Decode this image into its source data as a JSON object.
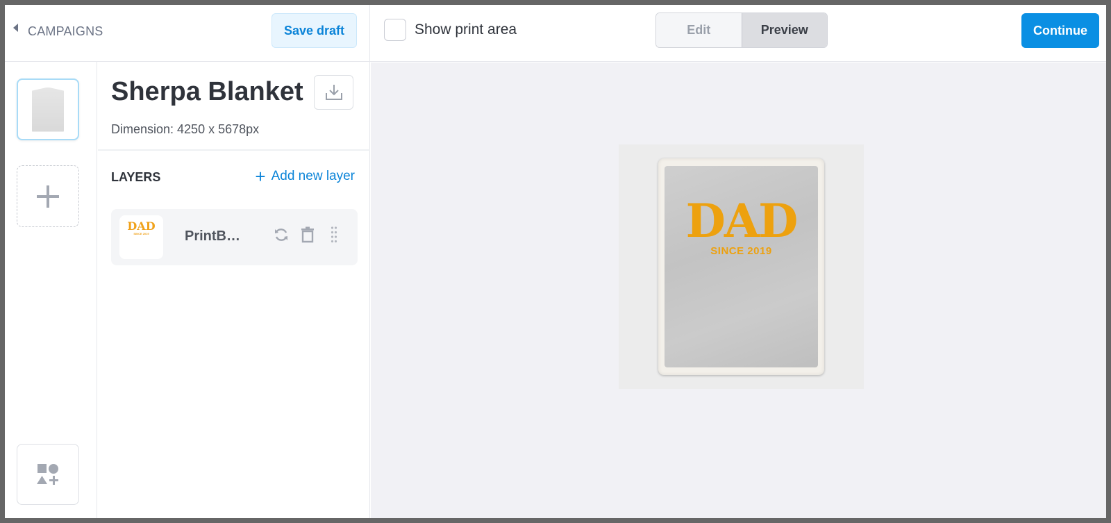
{
  "header": {
    "back_label": "CAMPAIGNS",
    "save_draft_label": "Save draft",
    "show_print_area_label": "Show print area",
    "show_print_area_checked": false,
    "view_modes": [
      "Edit",
      "Preview"
    ],
    "active_view_mode": "Preview",
    "continue_label": "Continue"
  },
  "rail": {
    "items": [
      {
        "icon": "blanket-thumbnail",
        "selected": true
      },
      {
        "icon": "plus-icon",
        "label": ""
      },
      {
        "icon": "shapes-icon"
      }
    ]
  },
  "product": {
    "title": "Sherpa Blanket",
    "dimension": "Dimension: 4250 x 5678px"
  },
  "layers": {
    "title": "LAYERS",
    "add_label": "Add new layer",
    "items": [
      {
        "name": "PrintB…",
        "thumb_title": "DAD",
        "thumb_subtitle": "SINCE 2019"
      }
    ]
  },
  "preview": {
    "design_title": "DAD",
    "design_subtitle": "SINCE 2019"
  },
  "colors": {
    "accent": "#0a8fe3",
    "design": "#eda10f",
    "canvas_bg": "#f1f1f5"
  }
}
